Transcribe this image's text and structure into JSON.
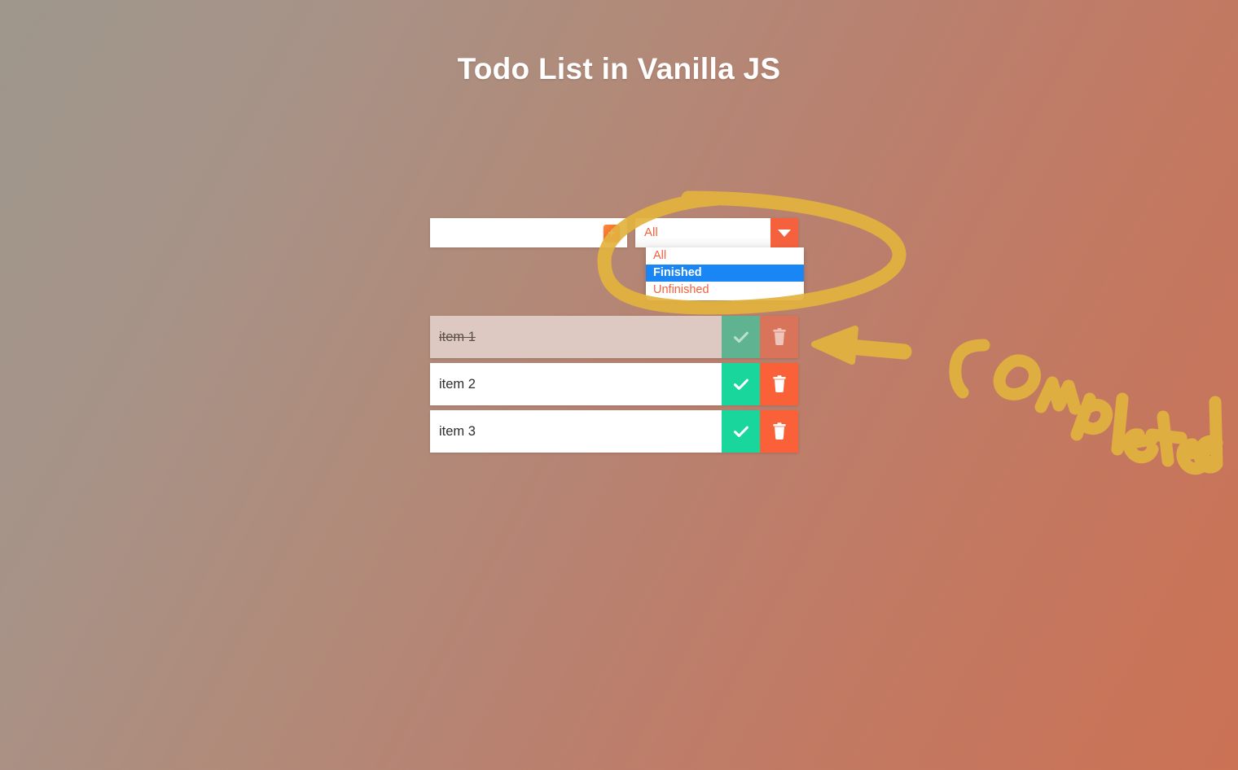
{
  "page": {
    "title": "Todo List in Vanilla JS"
  },
  "colors": {
    "accent_orange": "#f4613c",
    "delete_orange": "#fa6138",
    "check_green": "#19d79c",
    "highlight_blue": "#1a86f5",
    "annotation_gold": "#e2b43f",
    "background_from": "#9e978c",
    "background_to": "#cb7254"
  },
  "add_form": {
    "input_value": "",
    "input_placeholder": "",
    "add_button_label": "+"
  },
  "filter": {
    "selected_value": "All",
    "arrow_glyph": "▼",
    "expanded": true,
    "options": [
      {
        "label": "All",
        "selected": false
      },
      {
        "label": "Finished",
        "selected": true
      },
      {
        "label": "Unfinished",
        "selected": false
      }
    ]
  },
  "todos": [
    {
      "text": "item 1",
      "done": true,
      "check_label": "✔",
      "delete_label": "🗑"
    },
    {
      "text": "item 2",
      "done": false,
      "check_label": "✔",
      "delete_label": "🗑"
    },
    {
      "text": "item 3",
      "done": false,
      "check_label": "✔",
      "delete_label": "🗑"
    }
  ],
  "annotations": {
    "ellipse_target": "filter dropdown",
    "arrow_target": "completed todo row",
    "handwritten_text": "completed"
  }
}
